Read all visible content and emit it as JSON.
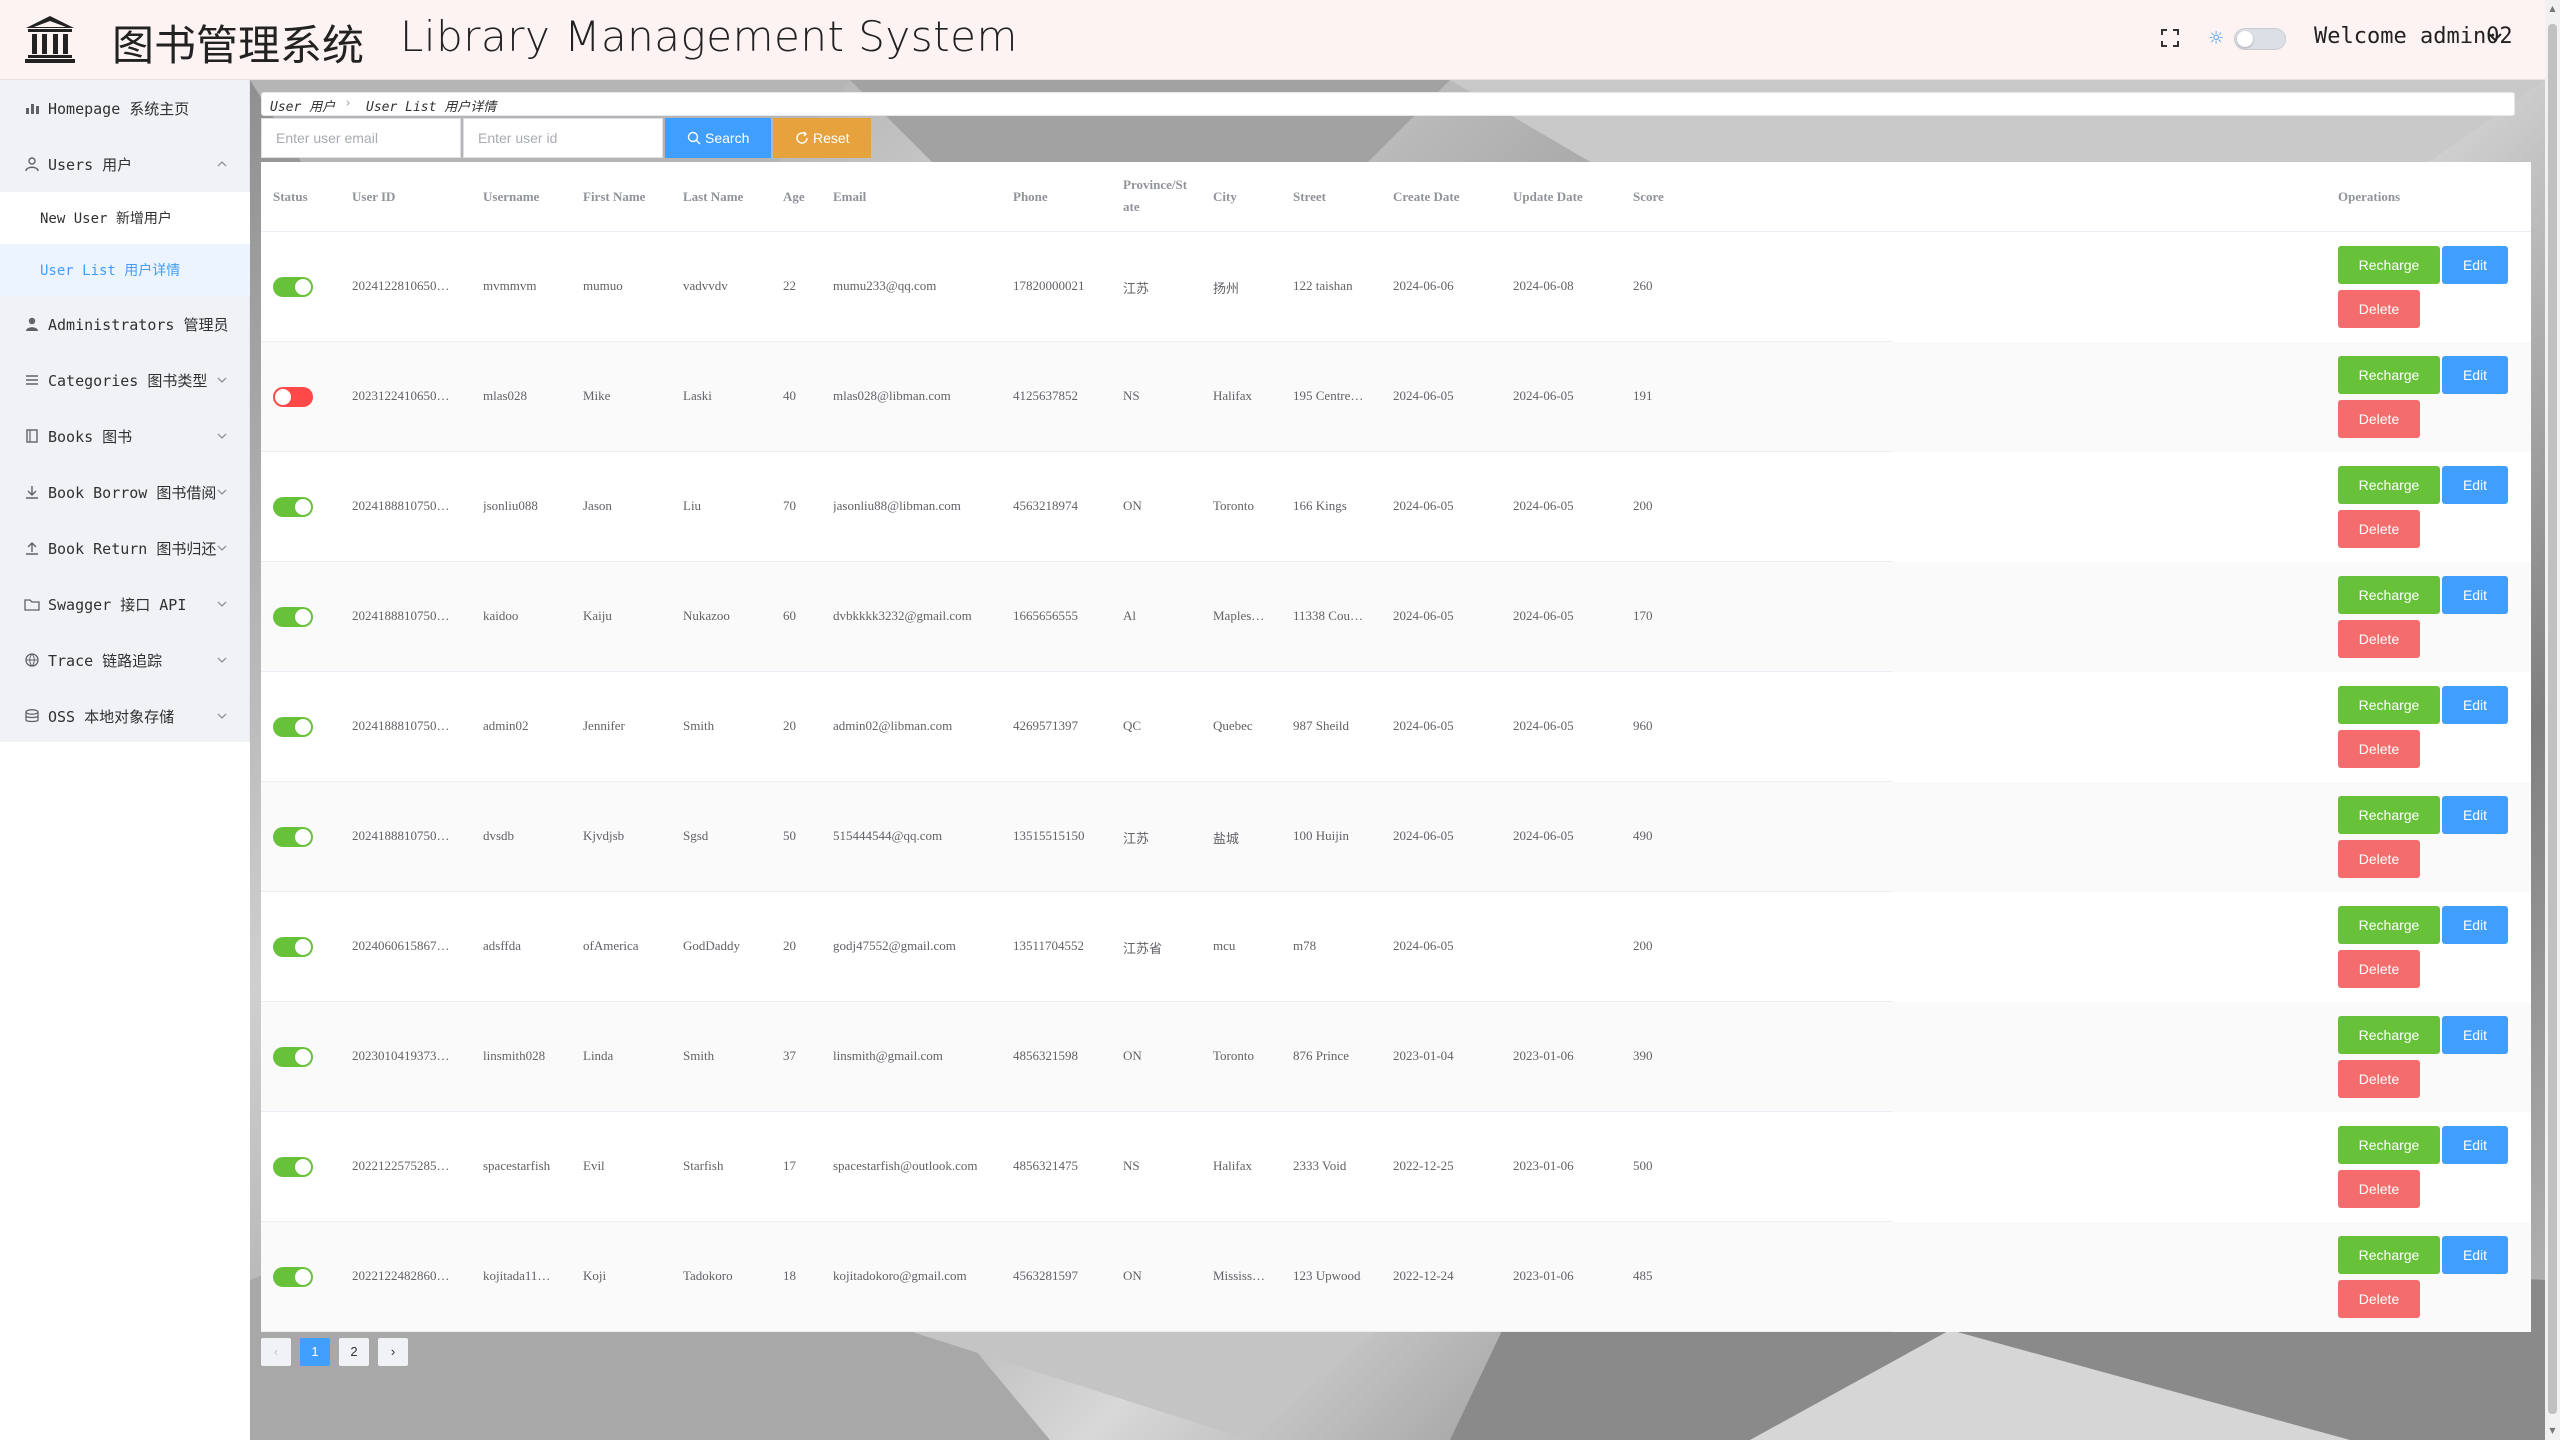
{
  "header": {
    "title_cn": "图书管理系统",
    "title_en": "Library Management System",
    "welcome": "Welcome admin02"
  },
  "sidebar": {
    "items": [
      {
        "label": "Homepage 系统主页",
        "icon": "bar-chart-icon"
      },
      {
        "label": "Users 用户",
        "icon": "user-icon"
      },
      {
        "label": "Administrators 管理员",
        "icon": "admin-icon"
      },
      {
        "label": "Categories 图书类型",
        "icon": "list-icon"
      },
      {
        "label": "Books 图书",
        "icon": "book-icon"
      },
      {
        "label": "Book Borrow 图书借阅",
        "icon": "download-icon"
      },
      {
        "label": "Book Return 图书归还",
        "icon": "upload-icon"
      },
      {
        "label": "Swagger 接口 API",
        "icon": "folder-icon"
      },
      {
        "label": "Trace 链路追踪",
        "icon": "globe-icon"
      },
      {
        "label": "OSS 本地对象存储",
        "icon": "database-icon"
      }
    ],
    "submenu": [
      {
        "label": "New User 新增用户"
      },
      {
        "label": "User List 用户详情"
      }
    ]
  },
  "breadcrumb": [
    "User 用户",
    "User List 用户详情"
  ],
  "search": {
    "email_placeholder": "Enter user email",
    "id_placeholder": "Enter user id",
    "search_label": "Search",
    "reset_label": "Reset"
  },
  "table": {
    "headers": {
      "status": "Status",
      "user_id": "User ID",
      "username": "Username",
      "first_name": "First Name",
      "last_name": "Last Name",
      "age": "Age",
      "email": "Email",
      "phone": "Phone",
      "province_1": "Province/St",
      "province_2": "ate",
      "city": "City",
      "street": "Street",
      "create_date": "Create Date",
      "update_date": "Update Date",
      "score": "Score",
      "operations": "Operations"
    },
    "buttons": {
      "recharge": "Recharge",
      "edit": "Edit",
      "delete": "Delete"
    },
    "rows": [
      {
        "status": true,
        "user_id": "2024122810650…",
        "username": "mvmmvm",
        "first_name": "mumuo",
        "last_name": "vadvvdv",
        "age": "22",
        "email": "mumu233@qq.com",
        "phone": "17820000021",
        "province": "江苏",
        "city": "扬州",
        "street": "122 taishan",
        "create_date": "2024-06-06",
        "update_date": "2024-06-08",
        "score": "260"
      },
      {
        "status": false,
        "user_id": "2023122410650…",
        "username": "mlas028",
        "first_name": "Mike",
        "last_name": "Laski",
        "age": "40",
        "email": "mlas028@libman.com",
        "phone": "4125637852",
        "province": "NS",
        "city": "Halifax",
        "street": "195 Centre…",
        "create_date": "2024-06-05",
        "update_date": "2024-06-05",
        "score": "191"
      },
      {
        "status": true,
        "user_id": "2024188810750…",
        "username": "jsonliu088",
        "first_name": "Jason",
        "last_name": "Liu",
        "age": "70",
        "email": "jasonliu88@libman.com",
        "phone": "4563218974",
        "province": "ON",
        "city": "Toronto",
        "street": "166 Kings",
        "create_date": "2024-06-05",
        "update_date": "2024-06-05",
        "score": "200"
      },
      {
        "status": true,
        "user_id": "2024188810750…",
        "username": "kaidoo",
        "first_name": "Kaiju",
        "last_name": "Nukazoo",
        "age": "60",
        "email": "dvbkkkk3232@gmail.com",
        "phone": "1665656555",
        "province": "Al",
        "city": "Maples…",
        "street": "11338 Cou…",
        "create_date": "2024-06-05",
        "update_date": "2024-06-05",
        "score": "170"
      },
      {
        "status": true,
        "user_id": "2024188810750…",
        "username": "admin02",
        "first_name": "Jennifer",
        "last_name": "Smith",
        "age": "20",
        "email": "admin02@libman.com",
        "phone": "4269571397",
        "province": "QC",
        "city": "Quebec",
        "street": "987 Sheild",
        "create_date": "2024-06-05",
        "update_date": "2024-06-05",
        "score": "960"
      },
      {
        "status": true,
        "user_id": "2024188810750…",
        "username": "dvsdb",
        "first_name": "Kjvdjsb",
        "last_name": "Sgsd",
        "age": "50",
        "email": "515444544@qq.com",
        "phone": "13515515150",
        "province": "江苏",
        "city": "盐城",
        "street": "100 Huijin",
        "create_date": "2024-06-05",
        "update_date": "2024-06-05",
        "score": "490"
      },
      {
        "status": true,
        "user_id": "2024060615867…",
        "username": "adsffda",
        "first_name": "ofAmerica",
        "last_name": "GodDaddy",
        "age": "20",
        "email": "godj47552@gmail.com",
        "phone": "13511704552",
        "province": "江苏省",
        "city": "mcu",
        "street": "m78",
        "create_date": "2024-06-05",
        "update_date": "",
        "score": "200"
      },
      {
        "status": true,
        "user_id": "2023010419373…",
        "username": "linsmith028",
        "first_name": "Linda",
        "last_name": "Smith",
        "age": "37",
        "email": "linsmith@gmail.com",
        "phone": "4856321598",
        "province": "ON",
        "city": "Toronto",
        "street": "876 Prince",
        "create_date": "2023-01-04",
        "update_date": "2023-01-06",
        "score": "390"
      },
      {
        "status": true,
        "user_id": "2022122575285…",
        "username": "spacestarfish",
        "first_name": "Evil",
        "last_name": "Starfish",
        "age": "17",
        "email": "spacestarfish@outlook.com",
        "phone": "4856321475",
        "province": "NS",
        "city": "Halifax",
        "street": "2333 Void",
        "create_date": "2022-12-25",
        "update_date": "2023-01-06",
        "score": "500"
      },
      {
        "status": true,
        "user_id": "2022122482860…",
        "username": "kojitada11…",
        "first_name": "Koji",
        "last_name": "Tadokoro",
        "age": "18",
        "email": "kojitadokoro@gmail.com",
        "phone": "4563281597",
        "province": "ON",
        "city": "Mississ…",
        "street": "123 Upwood",
        "create_date": "2022-12-24",
        "update_date": "2023-01-06",
        "score": "485"
      }
    ]
  },
  "pagination": {
    "prev": "‹",
    "pages": [
      "1",
      "2"
    ],
    "next": "›",
    "current": "1"
  },
  "colors": {
    "primary": "#409eff",
    "success": "#67c23a",
    "danger": "#f56c6c",
    "warning": "#e6a23c",
    "switch_off": "#ff4949"
  }
}
